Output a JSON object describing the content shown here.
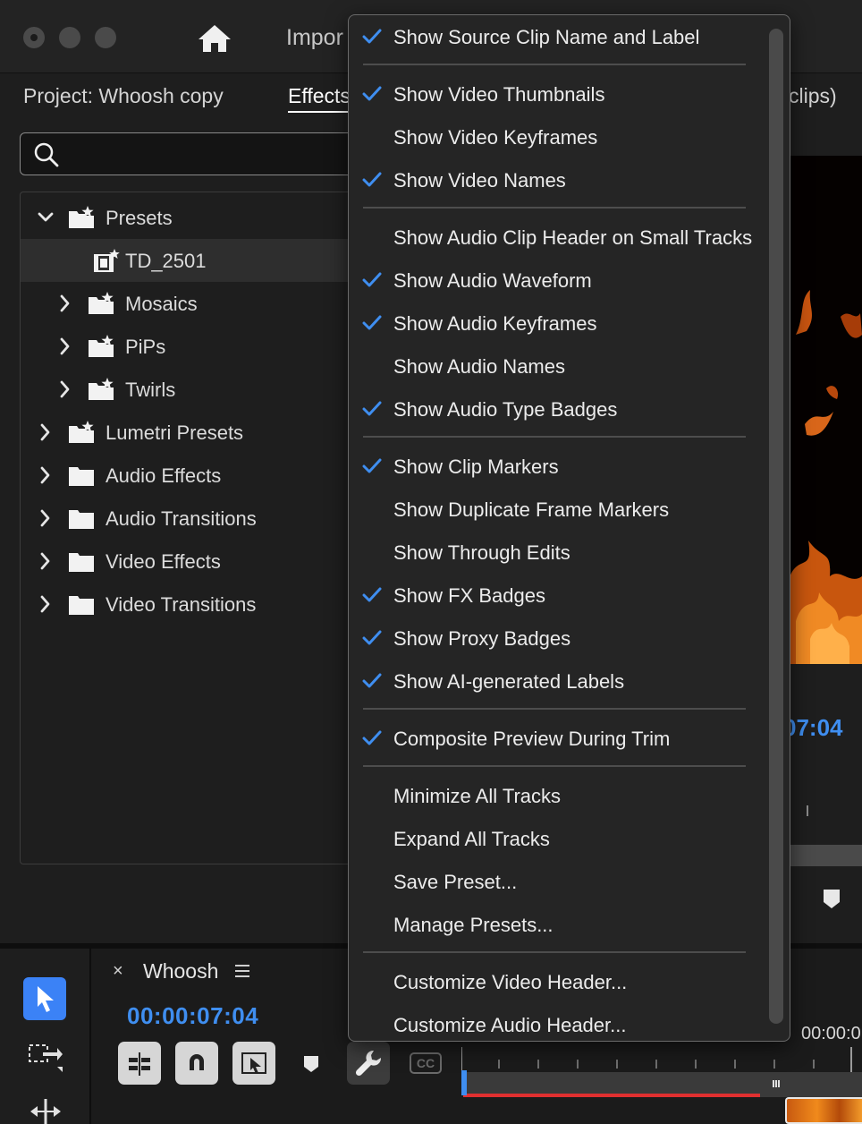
{
  "window": {
    "import_tab": "Impor",
    "project_tab": "Project: Whoosh copy",
    "effects_tab": "Effects",
    "clips_tab": "clips)"
  },
  "tree": {
    "items": [
      {
        "label": "Presets",
        "expanded": true,
        "level": 0,
        "icon": "preset-folder-icon"
      },
      {
        "label": "TD_2501",
        "level": 2,
        "icon": "preset-clip-icon",
        "selected": true
      },
      {
        "label": "Mosaics",
        "level": 1,
        "icon": "preset-folder-icon"
      },
      {
        "label": "PiPs",
        "level": 1,
        "icon": "preset-folder-icon"
      },
      {
        "label": "Twirls",
        "level": 1,
        "icon": "preset-folder-icon"
      },
      {
        "label": "Lumetri Presets",
        "level": 0,
        "icon": "preset-folder-icon"
      },
      {
        "label": "Audio Effects",
        "level": 0,
        "icon": "folder-icon"
      },
      {
        "label": "Audio Transitions",
        "level": 0,
        "icon": "folder-icon"
      },
      {
        "label": "Video Effects",
        "level": 0,
        "icon": "folder-icon"
      },
      {
        "label": "Video Transitions",
        "level": 0,
        "icon": "folder-icon"
      }
    ]
  },
  "menu": {
    "items": [
      {
        "label": "Show Source Clip Name and Label",
        "checked": true
      },
      {
        "label": "Show Video Thumbnails",
        "checked": true
      },
      {
        "label": "Show Video Keyframes",
        "checked": false
      },
      {
        "label": "Show Video Names",
        "checked": true
      },
      {
        "label": "Show Audio Clip Header on Small Tracks",
        "checked": false
      },
      {
        "label": "Show Audio Waveform",
        "checked": true
      },
      {
        "label": "Show Audio Keyframes",
        "checked": true
      },
      {
        "label": "Show Audio Names",
        "checked": false
      },
      {
        "label": "Show Audio Type Badges",
        "checked": true
      },
      {
        "label": "Show Clip Markers",
        "checked": true
      },
      {
        "label": "Show Duplicate Frame Markers",
        "checked": false
      },
      {
        "label": "Show Through Edits",
        "checked": false
      },
      {
        "label": "Show FX Badges",
        "checked": true
      },
      {
        "label": "Show Proxy Badges",
        "checked": true
      },
      {
        "label": "Show AI-generated Labels",
        "checked": true
      },
      {
        "label": "Composite Preview During Trim",
        "checked": true
      },
      {
        "label": "Minimize All Tracks",
        "checked": false
      },
      {
        "label": "Expand All Tracks",
        "checked": false
      },
      {
        "label": "Save Preset...",
        "checked": false
      },
      {
        "label": "Manage Presets...",
        "checked": false
      },
      {
        "label": "Customize Video Header...",
        "checked": false
      },
      {
        "label": "Customize Audio Header...",
        "checked": false
      }
    ]
  },
  "timeline": {
    "close": "×",
    "sequence_name": "Whoosh",
    "timecode": "00:00:07:04",
    "ruler_timecode": "00:00:0",
    "cc_label": "CC"
  },
  "program": {
    "timecode": "07:04"
  },
  "colors": {
    "accent": "#3f8ef0",
    "check": "#3f8ef0",
    "playhead_red": "#e03030"
  }
}
